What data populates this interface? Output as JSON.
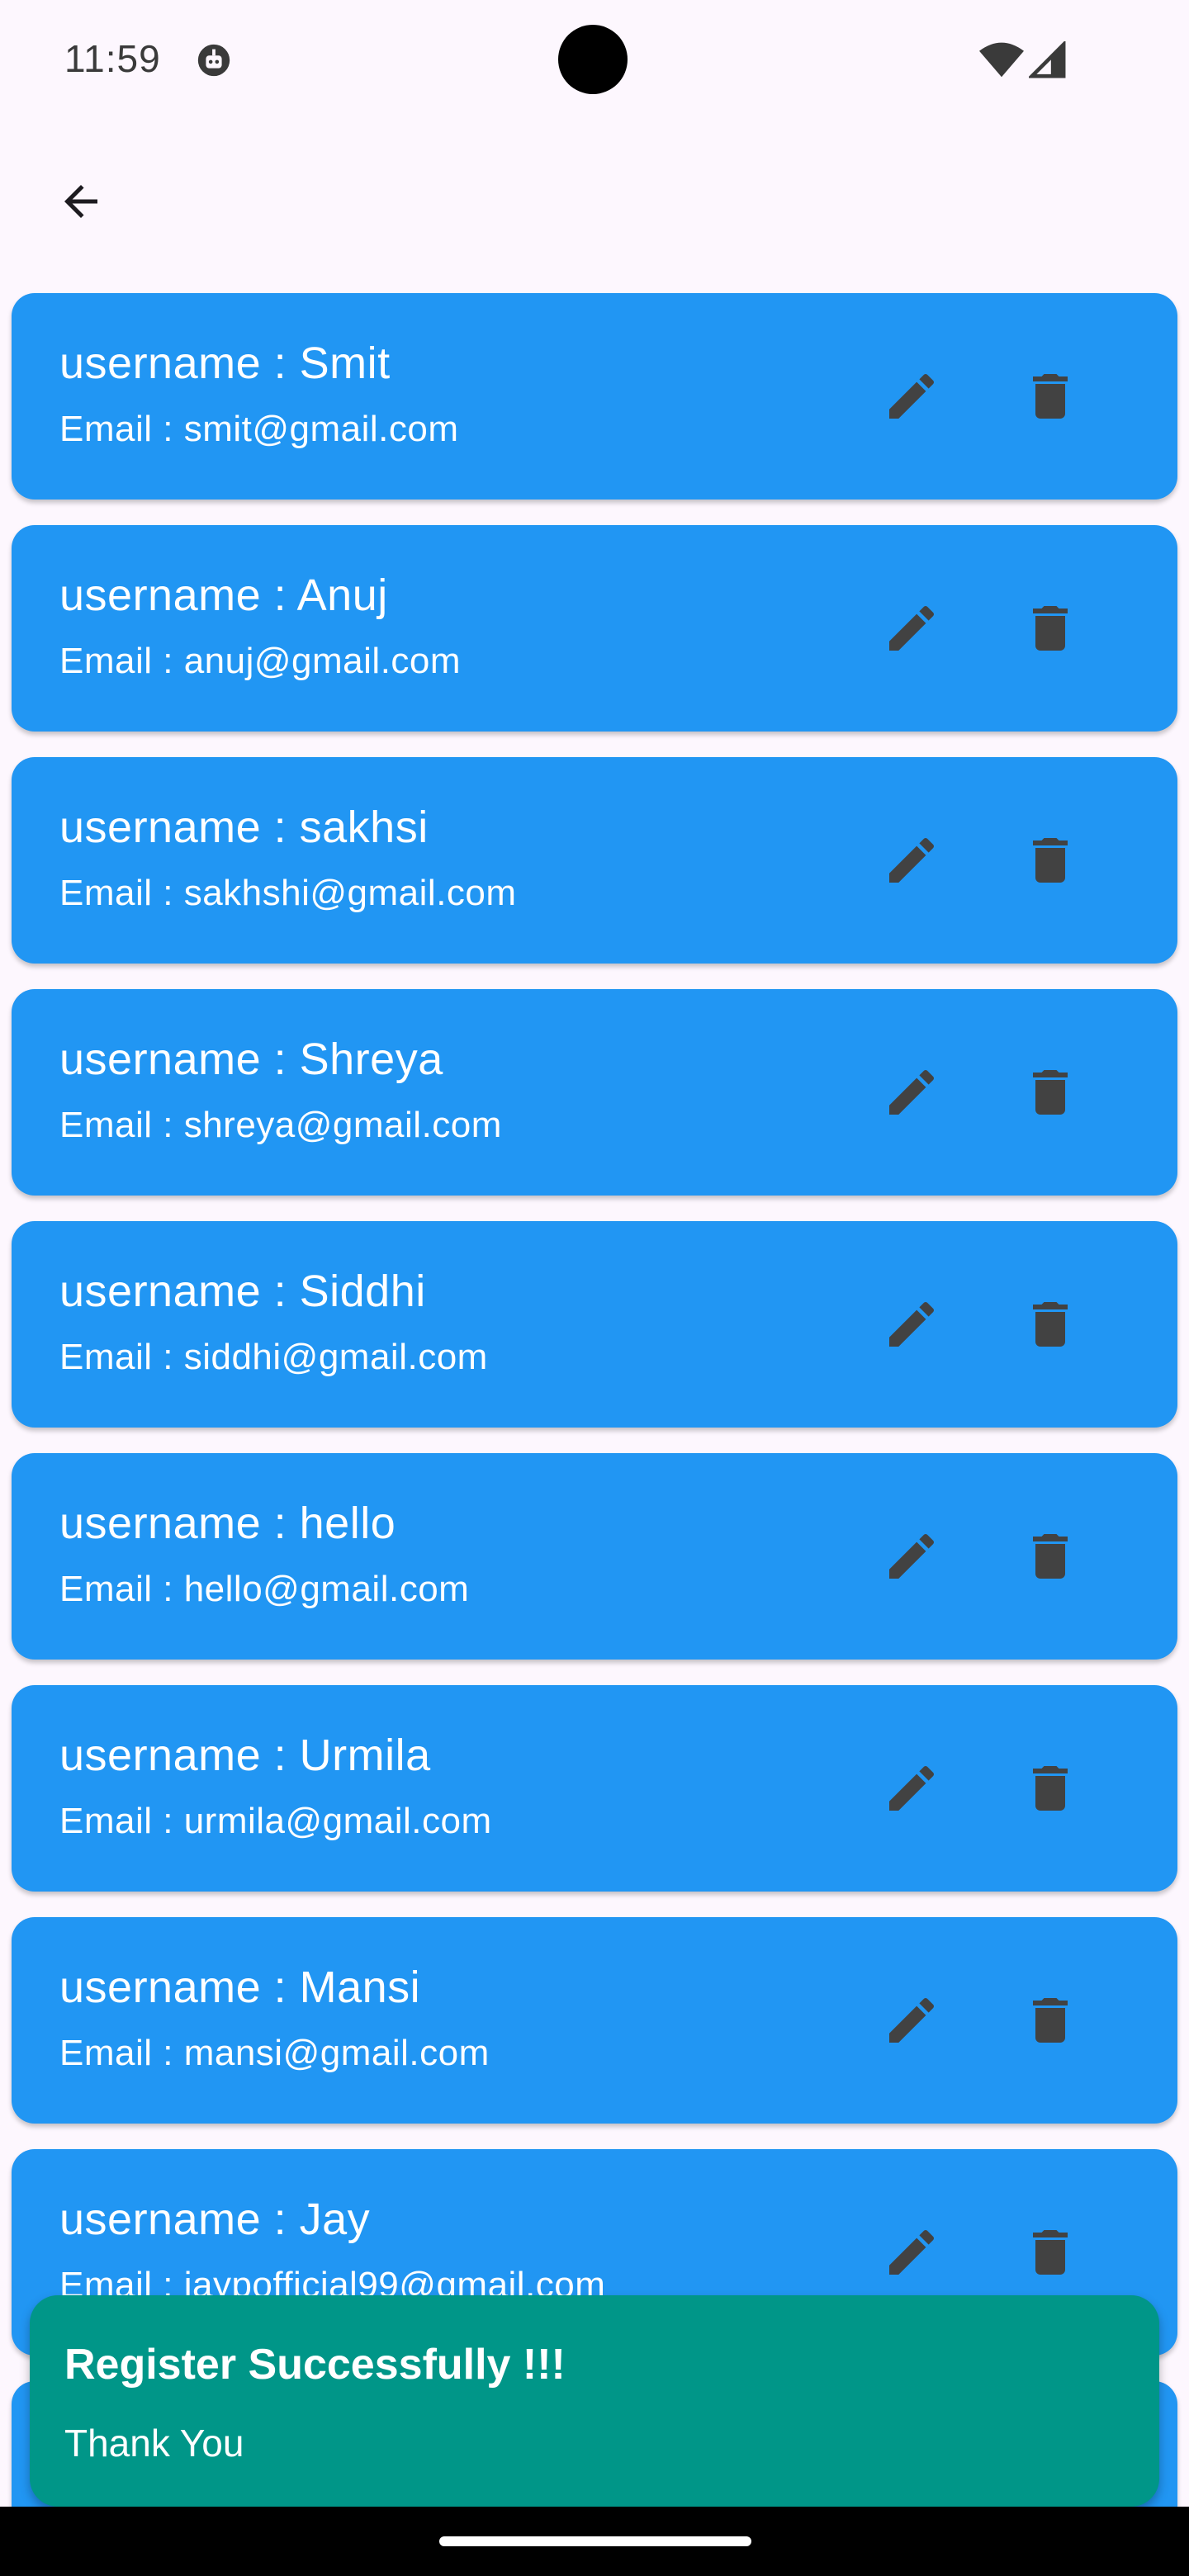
{
  "status_bar": {
    "time": "11:59"
  },
  "app_bar": {
    "back_icon": "arrow-back-icon"
  },
  "users": [
    {
      "username": "username : Smit",
      "email": "Email : smit@gmail.com"
    },
    {
      "username": "username : Anuj",
      "email": "Email : anuj@gmail.com"
    },
    {
      "username": "username : sakhsi",
      "email": "Email : sakhshi@gmail.com"
    },
    {
      "username": "username : Shreya",
      "email": "Email : shreya@gmail.com"
    },
    {
      "username": "username : Siddhi",
      "email": "Email : siddhi@gmail.com"
    },
    {
      "username": "username : hello",
      "email": "Email : hello@gmail.com"
    },
    {
      "username": "username : Urmila",
      "email": "Email : urmila@gmail.com"
    },
    {
      "username": "username : Mansi",
      "email": "Email : mansi@gmail.com"
    },
    {
      "username": "username : Jay",
      "email": "Email : jaypofficial99@gmail.com"
    }
  ],
  "card_icons": {
    "edit": "pencil-icon",
    "delete": "trash-icon"
  },
  "snackbar": {
    "title": "Register Successfully !!!",
    "message": "Thank You"
  },
  "colors": {
    "background": "#fdf7fe",
    "card": "#2196f3",
    "card_text": "#ffffff",
    "icon": "#424242",
    "snackbar": "#009688"
  }
}
